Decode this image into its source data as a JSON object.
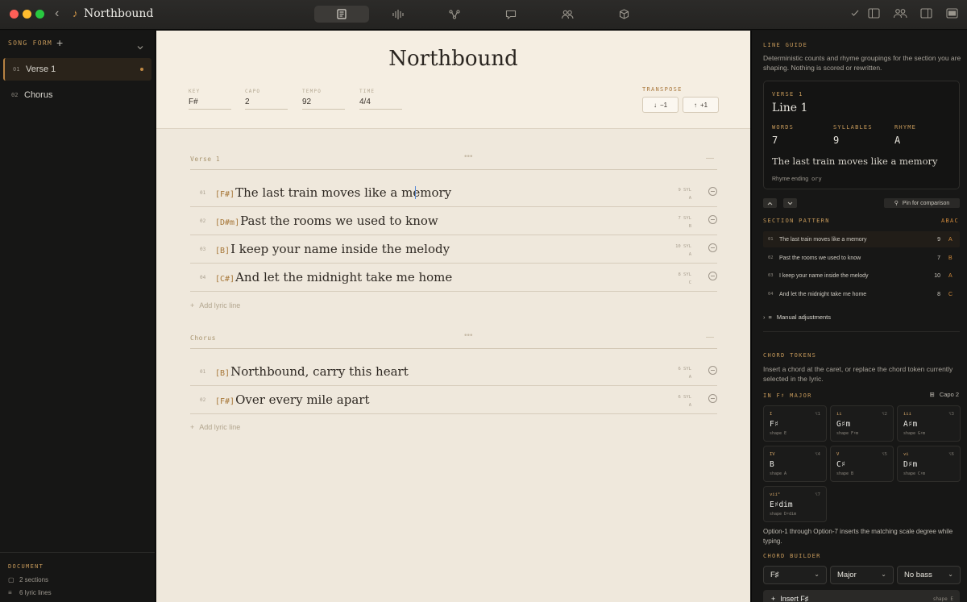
{
  "app": {
    "title": "Northbound"
  },
  "colors": {
    "accent": "#c79a5a",
    "chord": "#a67637",
    "caret": "#5a8bd6"
  },
  "toolbar": {
    "icons": [
      "lyrics-icon",
      "waveform-icon",
      "graph-icon",
      "comment-icon",
      "people-icon",
      "package-icon"
    ],
    "right_icons": [
      "check-icon",
      "panel-left-icon",
      "collaborators-icon",
      "panel-right-icon",
      "sidebar-icon"
    ]
  },
  "sidebar": {
    "heading": "SONG FORM",
    "items": [
      {
        "num": "01",
        "label": "Verse 1"
      },
      {
        "num": "02",
        "label": "Chorus"
      }
    ],
    "footer": {
      "heading": "DOCUMENT",
      "sections": "2 sections",
      "lines": "6 lyric lines"
    }
  },
  "document": {
    "title": "Northbound",
    "meta": [
      {
        "label": "KEY",
        "value": "F#"
      },
      {
        "label": "CAPO",
        "value": "2"
      },
      {
        "label": "TEMPO",
        "value": "92"
      },
      {
        "label": "TIME",
        "value": "4/4"
      }
    ],
    "transpose": {
      "label": "TRANSPOSE",
      "down": "−1",
      "up": "+1"
    },
    "sections": [
      {
        "name": "Verse 1",
        "add": "Add lyric line",
        "lines": [
          {
            "num": "01",
            "chord": "[F#]",
            "text": "The last train moves like a memory",
            "syl": "9 SYL",
            "rhyme": "A"
          },
          {
            "num": "02",
            "chord": "[D#m]",
            "text": "Past the rooms we used to know",
            "syl": "7 SYL",
            "rhyme": "B"
          },
          {
            "num": "03",
            "chord": "[B]",
            "text": "I keep your name inside the melody",
            "syl": "10 SYL",
            "rhyme": "A"
          },
          {
            "num": "04",
            "chord": "[C#]",
            "text": "And let the midnight take me home",
            "syl": "8 SYL",
            "rhyme": "C"
          }
        ]
      },
      {
        "name": "Chorus",
        "add": "Add lyric line",
        "lines": [
          {
            "num": "01",
            "chord": "[B]",
            "text": "Northbound, carry this heart",
            "syl": "6 SYL",
            "rhyme": "A"
          },
          {
            "num": "02",
            "chord": "[F#]",
            "text": "Over every mile apart",
            "syl": "6 SYL",
            "rhyme": "A"
          }
        ]
      }
    ]
  },
  "guide": {
    "heading": "LINE GUIDE",
    "desc": "Deterministic counts and rhyme groupings for the section you are shaping. Nothing is scored or rewritten.",
    "card": {
      "section": "VERSE 1",
      "line": "Line 1",
      "words_label": "WORDS",
      "words": "7",
      "syl_label": "SYLLABLES",
      "syl": "9",
      "rhyme_label": "RHYME",
      "rhyme": "A",
      "quote": "The last train moves like a memory",
      "ending_label": "Rhyme ending",
      "ending": "ory"
    },
    "pin": "Pin for comparison",
    "pattern_heading": "SECTION PATTERN",
    "pattern": "ABAC",
    "pattern_rows": [
      {
        "num": "01",
        "text": "The last train moves like a memory",
        "syl": "9",
        "rhyme": "A"
      },
      {
        "num": "02",
        "text": "Past the rooms we used to know",
        "syl": "7",
        "rhyme": "B"
      },
      {
        "num": "03",
        "text": "I keep your name inside the melody",
        "syl": "10",
        "rhyme": "A"
      },
      {
        "num": "04",
        "text": "And let the midnight take me home",
        "syl": "8",
        "rhyme": "C"
      }
    ],
    "manual": "Manual adjustments"
  },
  "chords": {
    "heading": "CHORD TOKENS",
    "desc": "Insert a chord at the caret, or replace the chord token currently selected in the lyric.",
    "key_heading": "IN F♯ MAJOR",
    "capo": "Capo 2",
    "cards": [
      {
        "deg": "I",
        "tag": "⌥1",
        "name": "F♯",
        "shape": "shape E"
      },
      {
        "deg": "ii",
        "tag": "⌥2",
        "name": "G♯m",
        "shape": "shape F♯m"
      },
      {
        "deg": "iii",
        "tag": "⌥3",
        "name": "A♯m",
        "shape": "shape G♯m"
      },
      {
        "deg": "IV",
        "tag": "⌥4",
        "name": "B",
        "shape": "shape A"
      },
      {
        "deg": "V",
        "tag": "⌥5",
        "name": "C♯",
        "shape": "shape B"
      },
      {
        "deg": "vi",
        "tag": "⌥6",
        "name": "D♯m",
        "shape": "shape C♯m"
      },
      {
        "deg": "vii°",
        "tag": "⌥7",
        "name": "E♯dim",
        "shape": "shape D♯dim"
      }
    ],
    "hint": "Option-1 through Option-7 inserts the matching scale degree while typing.",
    "builder_heading": "CHORD BUILDER",
    "builder": {
      "root": "F♯",
      "quality": "Major",
      "bass": "No bass"
    },
    "insert_label": "Insert F♯",
    "insert_shape": "shape E"
  }
}
